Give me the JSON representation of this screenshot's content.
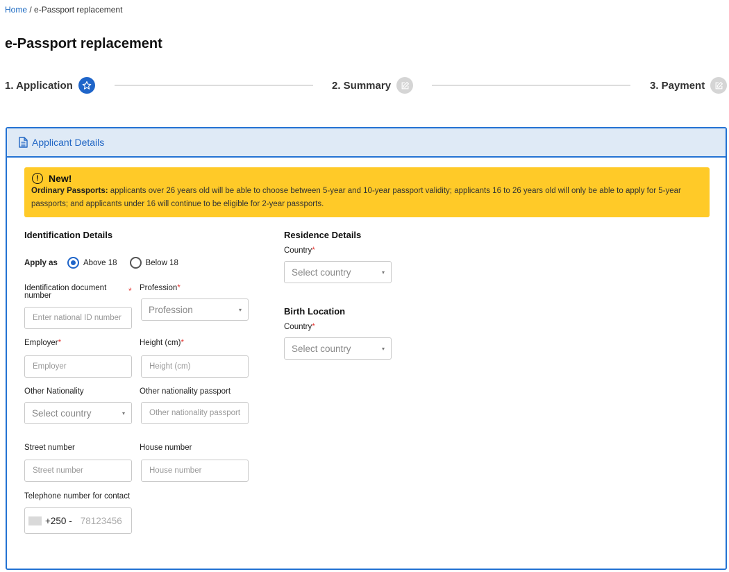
{
  "breadcrumb": {
    "home": "Home",
    "separator": " / ",
    "current": "e-Passport replacement"
  },
  "page_title": "e-Passport replacement",
  "steps": [
    {
      "label": "1. Application",
      "icon": "star-icon",
      "state": "active"
    },
    {
      "label": "2. Summary",
      "icon": "edit-icon",
      "state": "inactive"
    },
    {
      "label": "3. Payment",
      "icon": "edit-icon",
      "state": "inactive"
    }
  ],
  "card": {
    "title": "Applicant Details",
    "icon": "document-icon"
  },
  "notice": {
    "title": "New!",
    "lead": "Ordinary Passports:",
    "body": " applicants over 26 years old will be able to choose between 5-year and 10-year passport validity; applicants 16 to 26 years old will only be able to apply for 5-year passports; and applicants under 16 will continue to be eligible for 2-year passports."
  },
  "identification": {
    "title": "Identification Details",
    "apply_as_label": "Apply as",
    "options": [
      "Above 18",
      "Below 18"
    ],
    "selected": "Above 18",
    "id_number": {
      "label": "Identification document number",
      "placeholder": "Enter national ID number",
      "required_mark": "*"
    },
    "profession": {
      "label": "Profession",
      "placeholder": "Profession",
      "required_mark": "*"
    },
    "employer": {
      "label": "Employer",
      "placeholder": "Employer",
      "required_mark": "*"
    },
    "height": {
      "label": "Height (cm)",
      "placeholder": "Height (cm)",
      "required_mark": "*"
    },
    "other_nationality": {
      "label": "Other Nationality",
      "placeholder": "Select country"
    },
    "other_passport": {
      "label": "Other nationality passport",
      "placeholder": "Other nationality passport"
    },
    "street": {
      "label": "Street number",
      "placeholder": "Street number"
    },
    "house": {
      "label": "House number",
      "placeholder": "House number"
    },
    "telephone": {
      "label": "Telephone number for contact",
      "dial_code": "+250",
      "dial_caret": "-",
      "placeholder": "78123456"
    }
  },
  "residence": {
    "title": "Residence Details",
    "country": {
      "label": "Country",
      "placeholder": "Select country",
      "required_mark": "*"
    }
  },
  "birth": {
    "title": "Birth Location",
    "country": {
      "label": "Country",
      "placeholder": "Select country",
      "required_mark": "*"
    }
  },
  "colors": {
    "accent": "#1f65c9",
    "notice_bg": "#ffca28",
    "header_bg": "#dfeaf6",
    "required": "#e53935"
  }
}
